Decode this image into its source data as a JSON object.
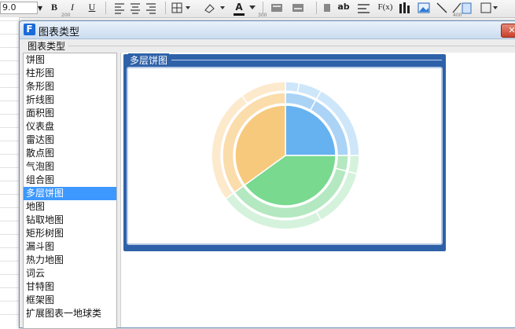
{
  "toolbar": {
    "font_size": "9.0",
    "bold": "B",
    "italic": "I",
    "underline": "U",
    "text_color_glyph": "A",
    "ab": "ab",
    "fx": "F(x)",
    "ruler_marks": [
      "200",
      "300",
      "400"
    ]
  },
  "dialog": {
    "title": "图表类型",
    "logo_glyph": "F",
    "close_glyph": "✕",
    "group_label": "图表类型"
  },
  "chart_types": [
    "饼图",
    "柱形图",
    "条形图",
    "折线图",
    "面积图",
    "仪表盘",
    "雷达图",
    "散点图",
    "气泡图",
    "组合图",
    "多层饼图",
    "地图",
    "钻取地图",
    "矩形树图",
    "漏斗图",
    "热力地图",
    "词云",
    "甘特图",
    "框架图",
    "扩展图表一地球类"
  ],
  "selected_type": "多层饼图",
  "preview": {
    "label": "多层饼图"
  },
  "chart_data": {
    "type": "pie",
    "subtype": "multi-level",
    "levels": [
      {
        "level": 1,
        "slices": [
          {
            "value": 25,
            "color": "#66b1ef"
          },
          {
            "value": 40,
            "color": "#78d98f"
          },
          {
            "value": 35,
            "color": "#f7c97c"
          }
        ]
      },
      {
        "level": 2,
        "slices": [
          {
            "value": 8,
            "color": "#aad3f6"
          },
          {
            "value": 17,
            "color": "#aad3f6"
          },
          {
            "value": 4,
            "color": "#b4e8c0"
          },
          {
            "value": 36,
            "color": "#b4e8c0"
          },
          {
            "value": 35,
            "color": "#fbdcab"
          }
        ]
      },
      {
        "level": 3,
        "slices": [
          {
            "value": 3,
            "color": "#cde6fa"
          },
          {
            "value": 5,
            "color": "#cde6fa"
          },
          {
            "value": 17,
            "color": "#cde6fa"
          },
          {
            "value": 4,
            "color": "#d5f2dc"
          },
          {
            "value": 13,
            "color": "#d5f2dc"
          },
          {
            "value": 23,
            "color": "#d5f2dc"
          },
          {
            "value": 25,
            "color": "#fde9cc"
          },
          {
            "value": 10,
            "color": "#fde9cc"
          }
        ]
      }
    ]
  },
  "colors": {
    "selection": "#3d98ff",
    "preview_frame": "#2f61a9",
    "close_button": "#c8412c"
  }
}
